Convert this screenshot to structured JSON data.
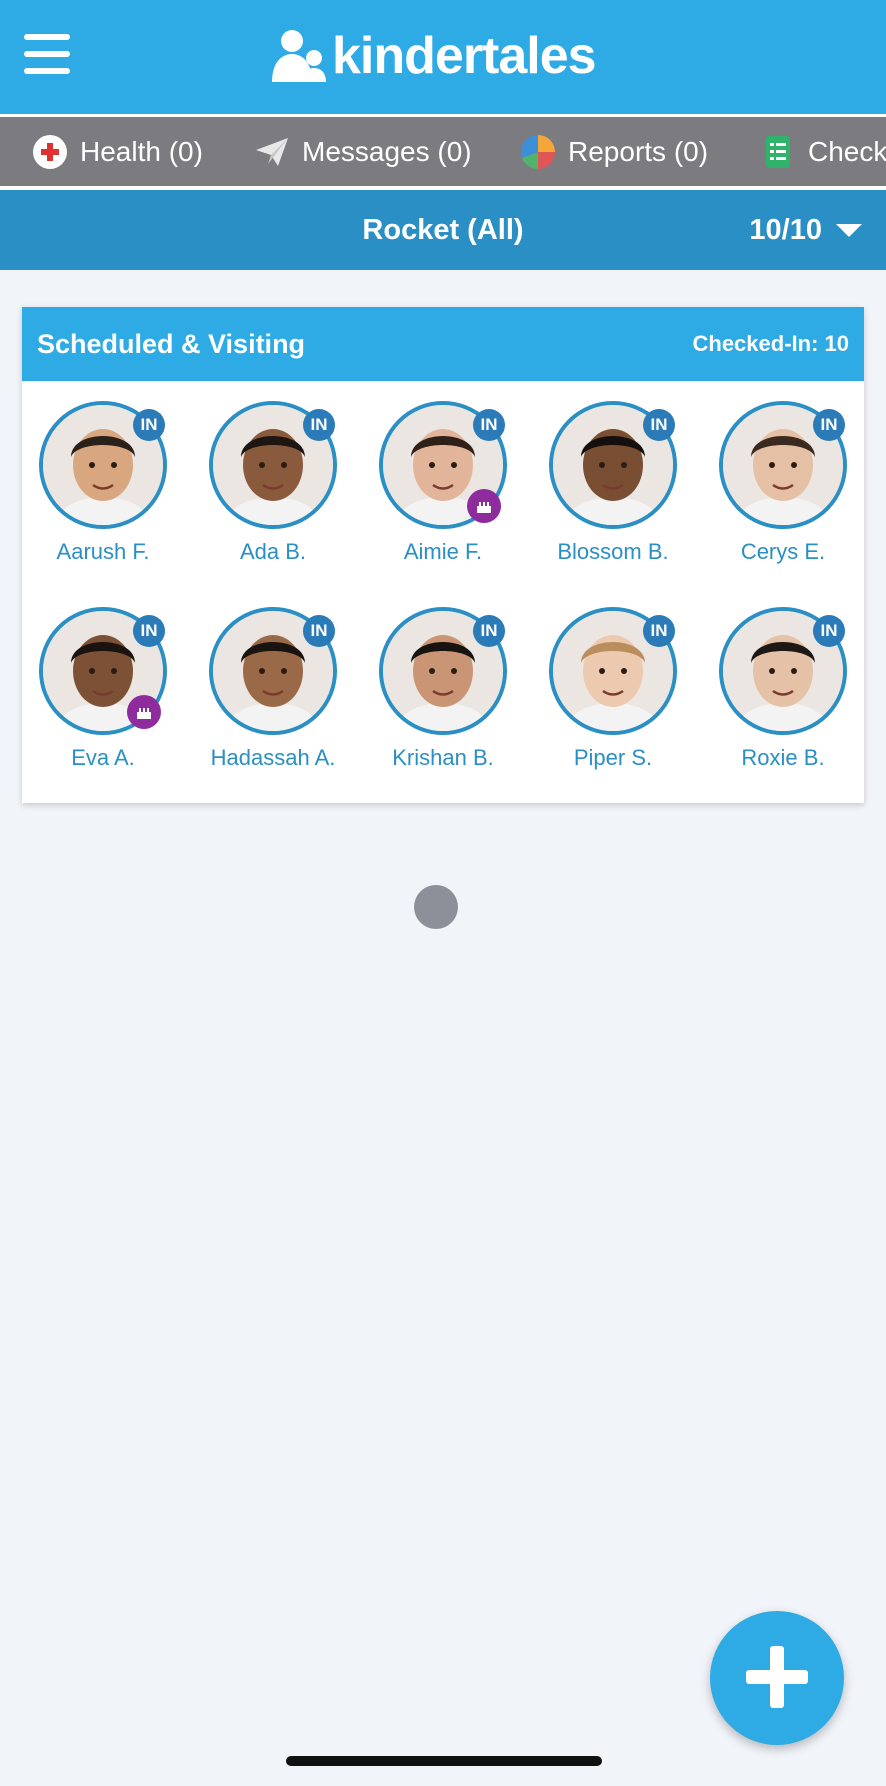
{
  "app": {
    "logo_text": "kindertales",
    "brand_color": "#2eaae4"
  },
  "nav": {
    "items": [
      {
        "label": "Health (0)",
        "icon": "health-cross-icon"
      },
      {
        "label": "Messages (0)",
        "icon": "paper-plane-icon"
      },
      {
        "label": "Reports (0)",
        "icon": "pie-chart-icon"
      },
      {
        "label": "Checkl",
        "icon": "checklist-icon"
      }
    ]
  },
  "classroom": {
    "title": "Rocket (All)",
    "count": "10/10"
  },
  "card": {
    "title": "Scheduled & Visiting",
    "count_label": "Checked-In: 10",
    "children": [
      {
        "name": "Aarush F.",
        "status": "IN",
        "birthday": false
      },
      {
        "name": "Ada B.",
        "status": "IN",
        "birthday": false
      },
      {
        "name": "Aimie F.",
        "status": "IN",
        "birthday": true
      },
      {
        "name": "Blossom B.",
        "status": "IN",
        "birthday": false
      },
      {
        "name": "Cerys E.",
        "status": "IN",
        "birthday": false
      },
      {
        "name": "Eva A.",
        "status": "IN",
        "birthday": true
      },
      {
        "name": "Hadassah A.",
        "status": "IN",
        "birthday": false
      },
      {
        "name": "Krishan B.",
        "status": "IN",
        "birthday": false
      },
      {
        "name": "Piper S.",
        "status": "IN",
        "birthday": false
      },
      {
        "name": "Roxie B.",
        "status": "IN",
        "birthday": false
      }
    ]
  }
}
